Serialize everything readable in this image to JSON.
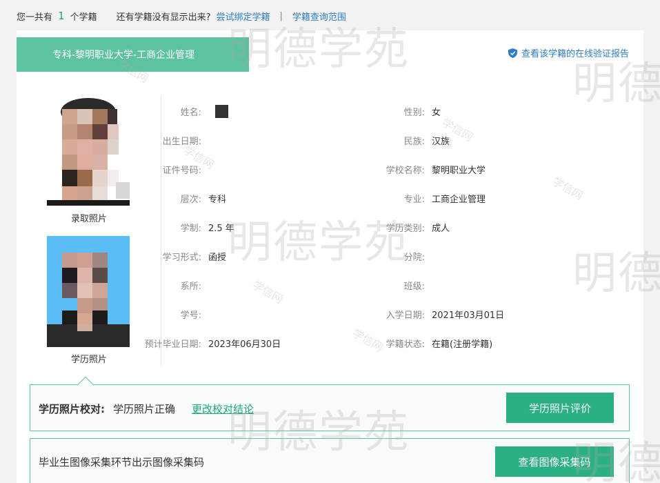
{
  "topbar": {
    "prefix": "您一共有",
    "count": "1",
    "suffix": "个学籍",
    "missing_text": "还有学籍没有显示出来?",
    "bind_link": "尝试绑定学籍",
    "separator": "|",
    "scope_link": "学籍查询范围"
  },
  "card": {
    "title": "专科-黎明职业大学-工商企业管理",
    "verify_link": "查看该学籍的在线验证报告"
  },
  "photos": {
    "admission_label": "录取照片",
    "degree_label": "学历照片"
  },
  "fields_left": [
    {
      "label": "姓名:",
      "value": ""
    },
    {
      "label": "出生日期:",
      "value": ""
    },
    {
      "label": "证件号码:",
      "value": ""
    },
    {
      "label": "层次:",
      "value": "专科"
    },
    {
      "label": "学制:",
      "value": "2.5 年"
    },
    {
      "label": "学习形式:",
      "value": "函授"
    },
    {
      "label": "系所:",
      "value": ""
    },
    {
      "label": "学号:",
      "value": ""
    },
    {
      "label": "预计毕业日期:",
      "value": "2023年06月30日"
    }
  ],
  "fields_right": [
    {
      "label": "性别:",
      "value": "女"
    },
    {
      "label": "民族:",
      "value": "汉族"
    },
    {
      "label": "学校名称:",
      "value": "黎明职业大学"
    },
    {
      "label": "专业:",
      "value": "工商企业管理"
    },
    {
      "label": "学历类别:",
      "value": "成人"
    },
    {
      "label": "分院:",
      "value": ""
    },
    {
      "label": "班级:",
      "value": ""
    },
    {
      "label": "入学日期:",
      "value": "2021年03月01日"
    },
    {
      "label": "学籍状态:",
      "value": "在籍(注册学籍)"
    }
  ],
  "photo_check": {
    "heading": "学历照片校对:",
    "result": "学历照片正确",
    "change_link": "更改校对结论",
    "button": "学历照片评价"
  },
  "image_code": {
    "text": "毕业生图像采集环节出示图像采集码",
    "button": "查看图像采集码"
  },
  "watermark": {
    "brand": "明德学苑",
    "brand_short": "明德",
    "site": "学信网"
  },
  "colors": {
    "accent": "#5dc2a0",
    "button": "#2bb085",
    "link": "#2e7dc5"
  }
}
